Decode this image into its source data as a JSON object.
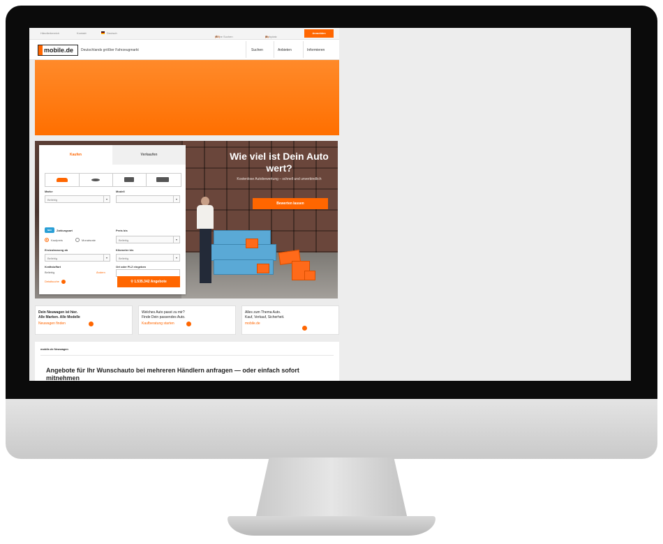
{
  "topbar": {
    "dealer_area": "Händlerbereich",
    "contact": "Kontakt",
    "language": "Deutsch",
    "my_searches_label": "Meine Suchen",
    "my_searches_count": "(37)",
    "parked_label": "Parkplatz",
    "parked_count": "(0)",
    "login_label": "Anmelden"
  },
  "header": {
    "logo_text": "mobile.de",
    "tagline": "Deutschlands größter Fahrzeugmarkt",
    "nav": [
      "Suchen",
      "Anbieten",
      "Informieren"
    ]
  },
  "search": {
    "tabs": [
      "Kaufen",
      "Verkaufen"
    ],
    "vehicle_icons": [
      "car-icon",
      "motorbike-icon",
      "van-icon",
      "truck-icon"
    ],
    "make_label": "Marke",
    "make_value": "Beliebig",
    "model_label": "Modell",
    "model_value": "",
    "new_badge": "NEU",
    "payment_label": "Zahlungsart",
    "payment_options": [
      "Kaufpreis",
      "Monatsrate"
    ],
    "price_label": "Preis bis",
    "price_value": "Beliebig",
    "registration_label": "Erstzulassung ab",
    "registration_value": "Beliebig",
    "mileage_label": "Kilometer bis",
    "mileage_value": "Beliebig",
    "fuel_label": "Kraftstoffart",
    "fuel_value": "Beliebig",
    "fuel_change": "Ändern",
    "location_label": "Ort oder PLZ eingeben",
    "location_placeholder": "",
    "detail_search": "Detailsuche",
    "search_button": "1.535.342 Angebote"
  },
  "promo": {
    "title": "Wie viel ist Dein Auto wert?",
    "text": "Kostenlose Autobewertung – schnell und unverbindlich",
    "button": "Bewerten lassen"
  },
  "cards": [
    {
      "line1": "Dein Neuwagen ist hier.",
      "line2": "Alle Marken. Alle Modelle",
      "link": "Neuwagen finden"
    },
    {
      "line1": "Welches Auto passt zu mir?",
      "line2": "Finde Dein passendes Auto.",
      "link": "Kaufberatung starten"
    },
    {
      "line1": "Alles zum Thema Auto.",
      "line2": "Kauf, Verkauf, Sicherheit.",
      "link": "mobile.de"
    }
  ],
  "section": {
    "label": "mobile.de Neuwagen",
    "headline": "Angebote für Ihr Wunschauto bei mehreren Händlern anfragen — oder einfach sofort mitnehmen"
  }
}
